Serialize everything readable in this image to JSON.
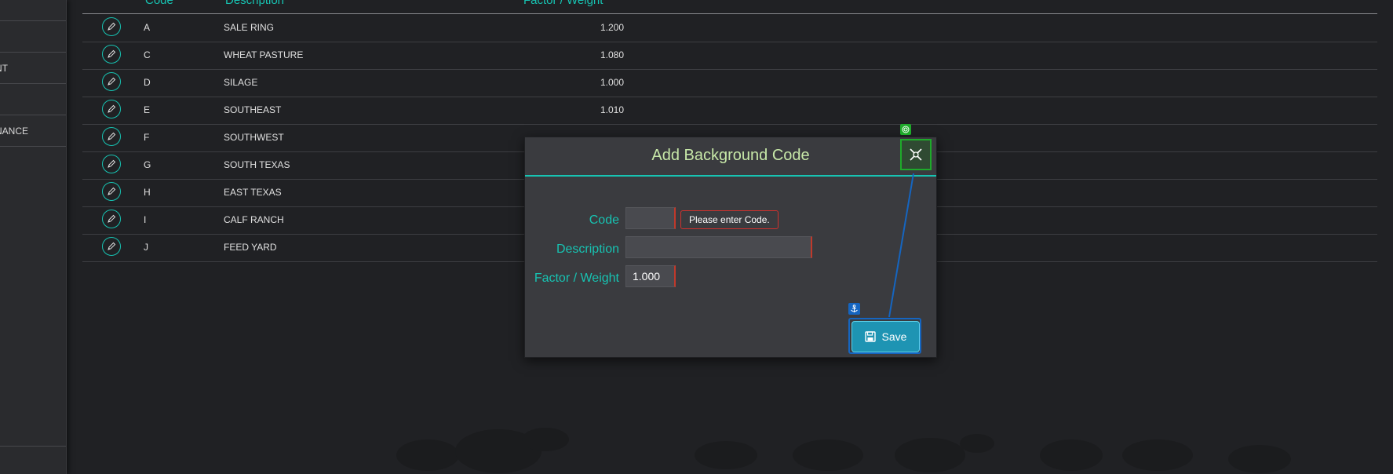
{
  "sidebar": {
    "items": [
      {
        "label": "NT"
      },
      {
        "label": "NANCE"
      }
    ]
  },
  "table": {
    "headers": {
      "code": "Code",
      "description": "Description",
      "factor": "Factor / Weight"
    },
    "rows": [
      {
        "code": "A",
        "description": "SALE RING",
        "factor": "1.200"
      },
      {
        "code": "C",
        "description": "WHEAT PASTURE",
        "factor": "1.080"
      },
      {
        "code": "D",
        "description": "SILAGE",
        "factor": "1.000"
      },
      {
        "code": "E",
        "description": "SOUTHEAST",
        "factor": "1.010"
      },
      {
        "code": "F",
        "description": "SOUTHWEST",
        "factor": ""
      },
      {
        "code": "G",
        "description": "SOUTH TEXAS",
        "factor": ""
      },
      {
        "code": "H",
        "description": "EAST TEXAS",
        "factor": ""
      },
      {
        "code": "I",
        "description": "CALF RANCH",
        "factor": ""
      },
      {
        "code": "J",
        "description": "FEED YARD",
        "factor": ""
      }
    ]
  },
  "modal": {
    "title": "Add Background Code",
    "code_label": "Code",
    "code_value": "",
    "code_error": "Please enter Code.",
    "description_label": "Description",
    "description_value": "",
    "factor_label": "Factor / Weight",
    "factor_value": "1.000",
    "save_label": "Save"
  },
  "colors": {
    "accent": "#17c3b2",
    "title": "#c7e8a8",
    "error": "#d0312d",
    "save": "#1e94b3",
    "close_highlight": "#1eaa2a",
    "anchor_highlight": "#1565c0"
  },
  "icons": {
    "edit": "pencil-icon",
    "close": "close-icon",
    "save": "floppy-disk-icon",
    "target": "target-icon",
    "anchor": "anchor-icon"
  }
}
